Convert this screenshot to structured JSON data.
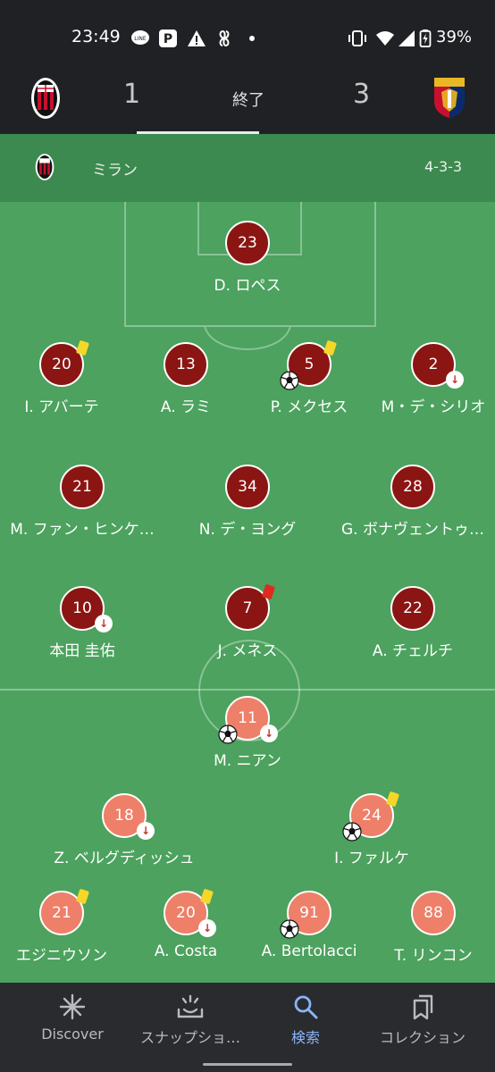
{
  "status_bar": {
    "time": "23:49",
    "battery": "39%",
    "line_badge": "LINE",
    "paypay_badge": "P"
  },
  "match": {
    "home_score": "1",
    "away_score": "3",
    "status": "終了",
    "home_crest": "ac-milan-crest",
    "away_crest": "genoa-crest"
  },
  "team": {
    "name": "ミラン",
    "formation": "4-3-3"
  },
  "colors": {
    "home_disc": "#8b1512",
    "away_disc": "#ee7f69",
    "pitch": "#4ca25e",
    "yellow_card": "#f6d629",
    "red_card": "#e0291f",
    "nav_active": "#8ab4f8"
  },
  "home_players": [
    {
      "number": "23",
      "name": "D. ロペス"
    },
    {
      "number": "20",
      "name": "I. アバーテ",
      "card": "yellow"
    },
    {
      "number": "13",
      "name": "A. ラミ"
    },
    {
      "number": "5",
      "name": "P. メクセス",
      "card": "yellow",
      "goal": true
    },
    {
      "number": "2",
      "name": "M・デ・シリオ",
      "sub_off": true
    },
    {
      "number": "21",
      "name": "M. ファン・ヒンケ…"
    },
    {
      "number": "34",
      "name": "N. デ・ヨング"
    },
    {
      "number": "28",
      "name": "G. ボナヴェントゥ…"
    },
    {
      "number": "10",
      "name": "本田 圭佑",
      "sub_off": true
    },
    {
      "number": "7",
      "name": "J. メネス",
      "card": "red"
    },
    {
      "number": "22",
      "name": "A. チェルチ"
    }
  ],
  "away_players": [
    {
      "number": "11",
      "name": "M. ニアン",
      "goal": true,
      "sub_off": true
    },
    {
      "number": "18",
      "name": "Z. ベルグディッシュ",
      "sub_off": true
    },
    {
      "number": "24",
      "name": "I. ファルケ",
      "card": "yellow",
      "goal": true
    },
    {
      "number": "21",
      "name": "エジニウソン",
      "card": "yellow"
    },
    {
      "number": "20",
      "name": "A. Costa",
      "card": "yellow",
      "sub_off": true
    },
    {
      "number": "91",
      "name": "A. Bertolacci",
      "goal": true
    },
    {
      "number": "88",
      "name": "T. リンコン"
    }
  ],
  "bottom_nav": [
    {
      "label": "Discover",
      "icon": "asterisk-icon"
    },
    {
      "label": "スナップショ…",
      "icon": "snapshot-icon"
    },
    {
      "label": "検索",
      "icon": "search-icon",
      "active": true
    },
    {
      "label": "コレクション",
      "icon": "collections-icon"
    }
  ]
}
